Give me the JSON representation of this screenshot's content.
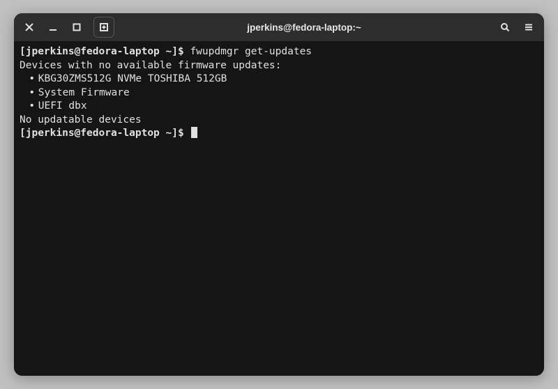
{
  "window": {
    "title": "jperkins@fedora-laptop:~"
  },
  "terminal": {
    "prompt": "[jperkins@fedora-laptop ~]$",
    "command1": "fwupdmgr get-updates",
    "output_header": "Devices with no available firmware updates:",
    "devices": [
      "KBG30ZMS512G NVMe TOSHIBA 512GB",
      "System Firmware",
      "UEFI dbx"
    ],
    "output_footer": "No updatable devices",
    "bullet": "•"
  }
}
